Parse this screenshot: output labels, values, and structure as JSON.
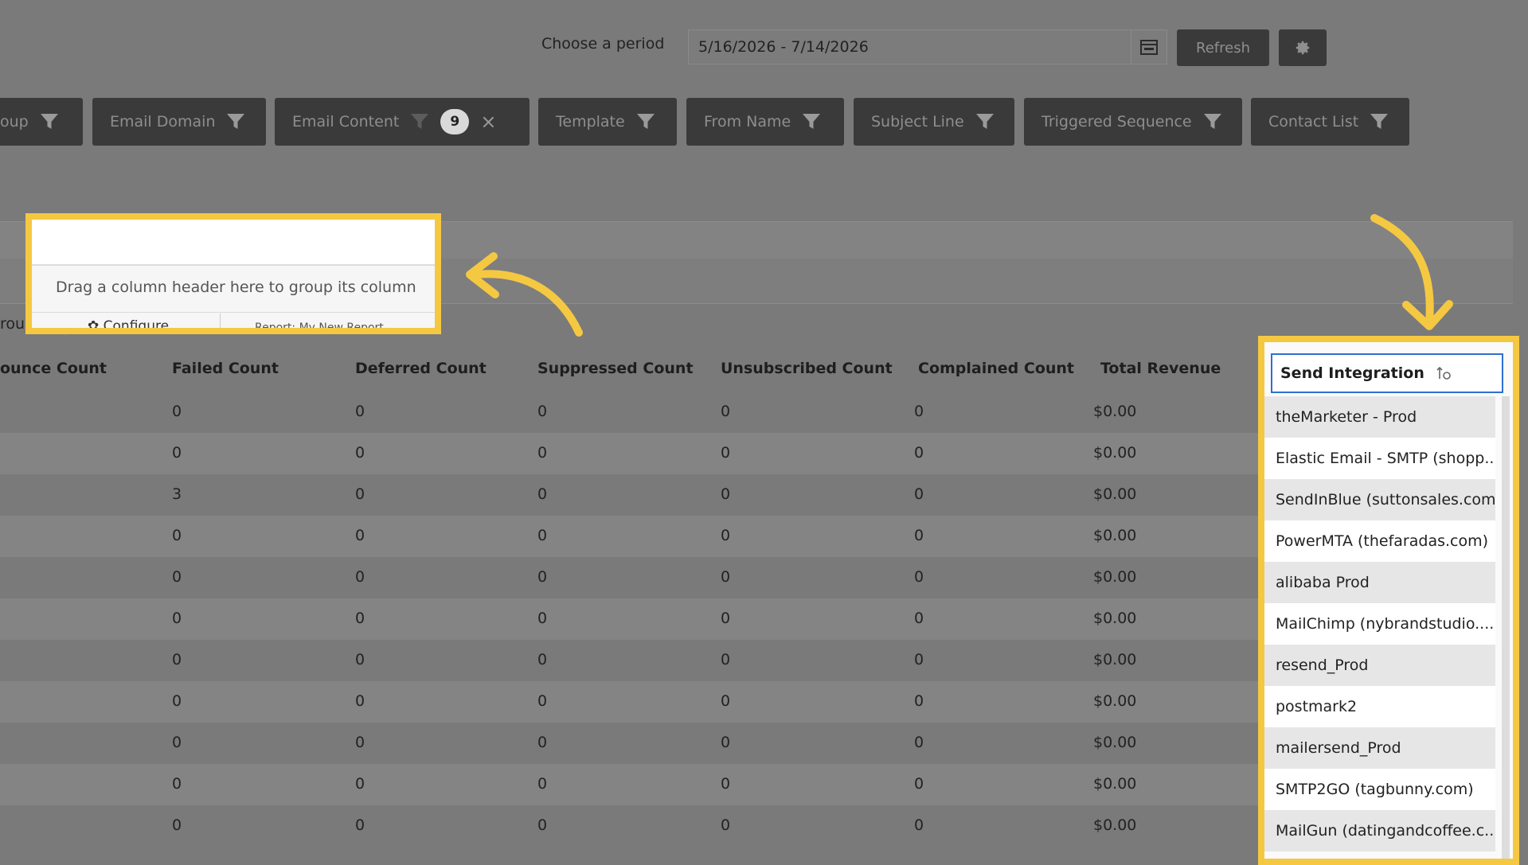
{
  "period": {
    "label": "Choose a period",
    "value": "5/16/2026 - 7/14/2026"
  },
  "toolbar": {
    "refresh_label": "Refresh"
  },
  "filters": [
    {
      "label": "oup",
      "left": 0
    },
    {
      "label": "Email Domain"
    },
    {
      "label": "Email Content",
      "badge": "9",
      "clear": "×"
    },
    {
      "label": "Template"
    },
    {
      "label": "From Name"
    },
    {
      "label": "Subject Line"
    },
    {
      "label": "Triggered Sequence"
    },
    {
      "label": "Contact List"
    }
  ],
  "grouping": {
    "drag_hint": "Drag a column header here to group its column",
    "configure": "Configure",
    "report": "Report: My New Report",
    "group_cut": "rou"
  },
  "columns": [
    "ounce Count",
    "Failed Count",
    "Deferred Count",
    "Suppressed Count",
    "Unsubscribed Count",
    "Complained Count",
    "Total Revenue"
  ],
  "rows": [
    [
      "0",
      "0",
      "0",
      "0",
      "0",
      "$0.00"
    ],
    [
      "0",
      "0",
      "0",
      "0",
      "0",
      "$0.00"
    ],
    [
      "3",
      "0",
      "0",
      "0",
      "0",
      "$0.00"
    ],
    [
      "0",
      "0",
      "0",
      "0",
      "0",
      "$0.00"
    ],
    [
      "0",
      "0",
      "0",
      "0",
      "0",
      "$0.00"
    ],
    [
      "0",
      "0",
      "0",
      "0",
      "0",
      "$0.00"
    ],
    [
      "0",
      "0",
      "0",
      "0",
      "0",
      "$0.00"
    ],
    [
      "0",
      "0",
      "0",
      "0",
      "0",
      "$0.00"
    ],
    [
      "0",
      "0",
      "0",
      "0",
      "0",
      "$0.00"
    ],
    [
      "0",
      "0",
      "0",
      "0",
      "0",
      "$0.00"
    ],
    [
      "0",
      "0",
      "0",
      "0",
      "0",
      "$0.00"
    ]
  ],
  "send_integration": {
    "title": "Send Integration",
    "items": [
      "theMarketer - Prod",
      "Elastic Email - SMTP (shopp...",
      "SendInBlue (suttonsales.com)",
      "PowerMTA (thefaradas.com)",
      "alibaba Prod",
      "MailChimp (nybrandstudio....",
      "resend_Prod",
      "postmark2",
      "mailersend_Prod",
      "SMTP2GO (tagbunny.com)",
      "MailGun (datingandcoffee.c..."
    ]
  },
  "colors": {
    "highlight": "#f5c842",
    "overlay": "#7a7a7a",
    "button": "#3a3a3a"
  },
  "icons": [
    "calendar-icon",
    "gear-icon",
    "filter-icon",
    "close-icon",
    "sort-icon"
  ]
}
